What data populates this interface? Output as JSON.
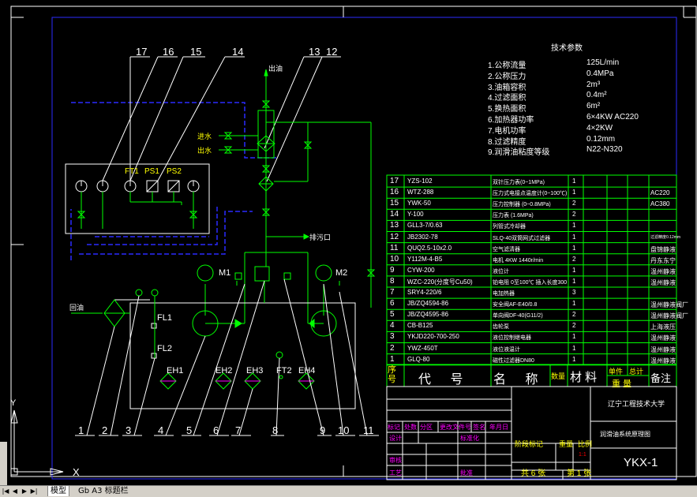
{
  "tech_params": {
    "title": "技术参数",
    "items": [
      {
        "label": "1.公称流量",
        "value": "125L/min"
      },
      {
        "label": "2.公称压力",
        "value": "0.4MPa"
      },
      {
        "label": "3.油箱容积",
        "value": "2m³"
      },
      {
        "label": "4.过滤面积",
        "value": "0.4m²"
      },
      {
        "label": "5.换热面积",
        "value": "6m²"
      },
      {
        "label": "6.加热器功率",
        "value": "6×4KW AC220"
      },
      {
        "label": "7.电机功率",
        "value": "4×2KW"
      },
      {
        "label": "8.过滤精度",
        "value": "0.12mm"
      },
      {
        "label": "9.润滑油粘度等级",
        "value": "N22-N320"
      }
    ]
  },
  "callouts_top": [
    "17",
    "16",
    "15",
    "14",
    "13",
    "12"
  ],
  "callouts_bottom": [
    "1",
    "2",
    "3",
    "4",
    "5",
    "6",
    "7",
    "8",
    "9",
    "10",
    "11"
  ],
  "schematic_labels": {
    "oil_out": "出油",
    "water_in": "进水",
    "water_out": "出水",
    "drain": "排污口",
    "return_oil": "回油",
    "ft1": "FT1",
    "ps1": "PS1",
    "ps2": "PS2",
    "m1": "M1",
    "m2": "M2",
    "fl1": "FL1",
    "fl2": "FL2",
    "eh1": "EH1",
    "eh2": "EH2",
    "eh3": "EH3",
    "eh4": "EH4",
    "ft2": "FT2"
  },
  "bom": {
    "rows": [
      {
        "no": "17",
        "code": "YZS-102",
        "name": "双针压力表(0~1MPa)",
        "qty": "1",
        "remark": ""
      },
      {
        "no": "16",
        "code": "WTZ-288",
        "name": "压力式电接点温度计(0~100℃)",
        "qty": "1",
        "remark": "AC220"
      },
      {
        "no": "15",
        "code": "YWK-50",
        "name": "压力控制器 (0~0.8MPa)",
        "qty": "2",
        "remark": "AC380"
      },
      {
        "no": "14",
        "code": "Y-100",
        "name": "压力表 (1.6MPa)",
        "qty": "2",
        "remark": ""
      },
      {
        "no": "13",
        "code": "GLL3-7/0.63",
        "name": "列管式冷却器",
        "qty": "1",
        "remark": ""
      },
      {
        "no": "12",
        "code": "JB2302-78",
        "name": "SLQ-40双筒网式过滤器",
        "qty": "1",
        "remark": "过滤精度0.12mm"
      },
      {
        "no": "11",
        "code": "QUQ2.5-10x2.0",
        "name": "空气滤清器",
        "qty": "1",
        "remark": "盘锦静液"
      },
      {
        "no": "10",
        "code": "Y112M-4-B5",
        "name": "电机 4KW 1440r/min",
        "qty": "2",
        "remark": "丹东东宁"
      },
      {
        "no": "9",
        "code": "CYW-200",
        "name": "液位计",
        "qty": "1",
        "remark": "温州静液"
      },
      {
        "no": "8",
        "code": "WZC-220(分度号Cu50)",
        "name": "铂电阻 0至100℃ 插入长度300",
        "qty": "1",
        "remark": "温州静液"
      },
      {
        "no": "7",
        "code": "SRY4-220/6",
        "name": "电加热器",
        "qty": "3",
        "remark": ""
      },
      {
        "no": "6",
        "code": "JB/ZQ4594-86",
        "name": "安全阀AF-E40/0.8",
        "qty": "1",
        "remark": "温州静液阀厂"
      },
      {
        "no": "5",
        "code": "JB/ZQ4595-86",
        "name": "单向阀DF-40(G11/2)",
        "qty": "2",
        "remark": "温州静液阀厂"
      },
      {
        "no": "4",
        "code": "CB-B125",
        "name": "齿轮泵",
        "qty": "2",
        "remark": "上海液压"
      },
      {
        "no": "3",
        "code": "YKJD220-700-250",
        "name": "液位控制继电器",
        "qty": "1",
        "remark": "温州静液"
      },
      {
        "no": "2",
        "code": "YWZ-450T",
        "name": "液位液温计",
        "qty": "1",
        "remark": "温州静液"
      },
      {
        "no": "1",
        "code": "GLQ-80",
        "name": "磁性过滤器DN80",
        "qty": "1",
        "remark": "温州静液"
      }
    ],
    "header": {
      "no": "序号",
      "code": "代 号",
      "name": "名 称",
      "qty": "数量",
      "material": "材 料",
      "unit": "单件",
      "total": "总计",
      "weight": "重 量",
      "remark": "备注"
    }
  },
  "title_block": {
    "institution": "辽宁工程技术大学",
    "drawing_title": "润滑油系统原理图",
    "drawing_number": "YKX-1",
    "stage_mark": "阶段标记",
    "weight": "重量",
    "scale": "比例",
    "scale_value": "1:1",
    "sheets_total": "共 6 张",
    "sheet_no": "第 1 张",
    "mark": "标记",
    "count": "处数",
    "zone": "分区",
    "change_doc": "更改文件号",
    "signature": "签名",
    "date": "年月日",
    "designer": "设计",
    "std": "标准化",
    "check": "审核",
    "process": "工艺",
    "approve": "批准"
  },
  "tabs": [
    "模型",
    "Gb A3 标题栏"
  ],
  "ucs": {
    "x": "X",
    "y": "Y"
  },
  "colors": {
    "green": "#00ff00",
    "blue": "#2b2bff",
    "white": "#ffffff",
    "yellow": "#ffff00",
    "magenta": "#ff00ff",
    "red": "#ff0000",
    "cyan": "#00ffff"
  }
}
